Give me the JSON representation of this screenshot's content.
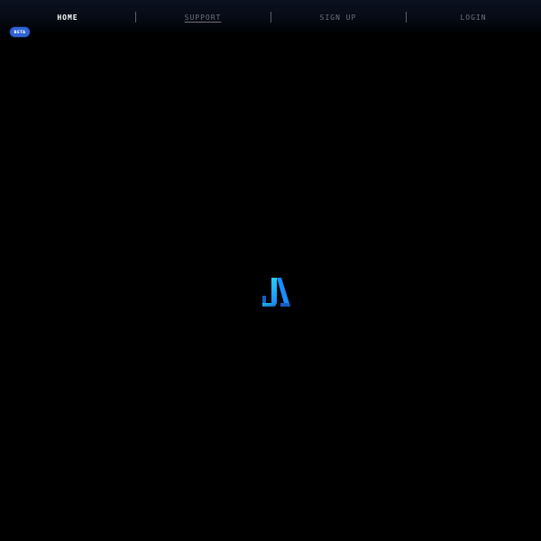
{
  "nav": {
    "items": [
      {
        "label": "HOME",
        "active": true
      },
      {
        "label": "SUPPORT",
        "active": false
      },
      {
        "label": "SIGN UP",
        "active": false
      },
      {
        "label": "LOGIN",
        "active": false
      }
    ]
  },
  "badge": {
    "label": "BETA"
  },
  "logo": {
    "icon": "brand-logo-icon",
    "colors": {
      "primary": "#1a8cff",
      "secondary": "#21c4f0",
      "dark": "#1560c8"
    }
  },
  "colors": {
    "background": "#000000",
    "nav_text": "#6d7480",
    "nav_active": "#ffffff",
    "badge": "#2f63d6"
  }
}
